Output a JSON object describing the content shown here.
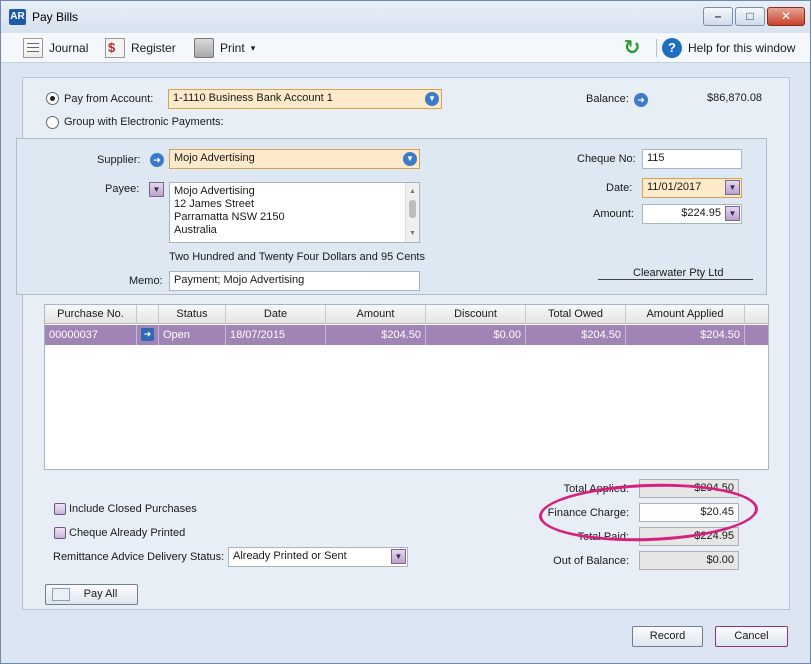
{
  "window": {
    "app_icon": "AR",
    "title": "Pay Bills",
    "buttons": {
      "minimize": "–",
      "maximize": "□",
      "close": "✕"
    }
  },
  "toolbar": {
    "journal": "Journal",
    "register": "Register",
    "print": "Print",
    "print_caret": "▾",
    "help": "Help for this window"
  },
  "pay_from": {
    "label": "Pay from Account:",
    "account": "1-1110 Business Bank Account 1",
    "group_label": "Group with Electronic Payments:",
    "balance_label": "Balance:",
    "balance_value": "$86,870.08"
  },
  "supplier": {
    "supplier_label": "Supplier:",
    "supplier_value": "Mojo Advertising",
    "payee_label": "Payee:",
    "payee_lines": [
      "Mojo Advertising",
      "12 James Street",
      "Parramatta  NSW  2150",
      "Australia"
    ],
    "amount_words": "Two Hundred and Twenty Four Dollars and 95 Cents",
    "memo_label": "Memo:",
    "memo_value": "Payment; Mojo Advertising",
    "cheque_no_label": "Cheque No:",
    "cheque_no_value": "115",
    "date_label": "Date:",
    "date_value": "11/01/2017",
    "amount_label": "Amount:",
    "amount_value": "$224.95",
    "company": "Clearwater Pty Ltd"
  },
  "grid": {
    "headers": [
      "Purchase No.",
      "",
      "Status",
      "Date",
      "Amount",
      "Discount",
      "Total Owed",
      "Amount Applied"
    ],
    "rows": [
      {
        "purchase_no": "00000037",
        "status": "Open",
        "date": "18/07/2015",
        "amount": "$204.50",
        "discount": "$0.00",
        "total_owed": "$204.50",
        "amount_applied": "$204.50"
      }
    ]
  },
  "options": {
    "include_closed": "Include Closed Purchases",
    "cheque_printed": "Cheque Already Printed",
    "remittance_label": "Remittance Advice Delivery Status:",
    "remittance_value": "Already Printed or Sent"
  },
  "summary": {
    "total_applied_label": "Total Applied:",
    "total_applied_value": "$204.50",
    "finance_charge_label": "Finance Charge:",
    "finance_charge_value": "$20.45",
    "total_paid_label": "Total Paid:",
    "total_paid_value": "$224.95",
    "out_of_balance_label": "Out of Balance:",
    "out_of_balance_value": "$0.00"
  },
  "actions": {
    "pay_all": "Pay All",
    "record": "Record",
    "cancel": "Cancel"
  },
  "colors": {
    "highlight_row": "#9f84b5",
    "annotation": "#d4217f",
    "required_field": "#fdeacb"
  },
  "icons": {
    "refresh": "↻",
    "help": "?",
    "arrow": "➜",
    "dropdown": "▼"
  }
}
